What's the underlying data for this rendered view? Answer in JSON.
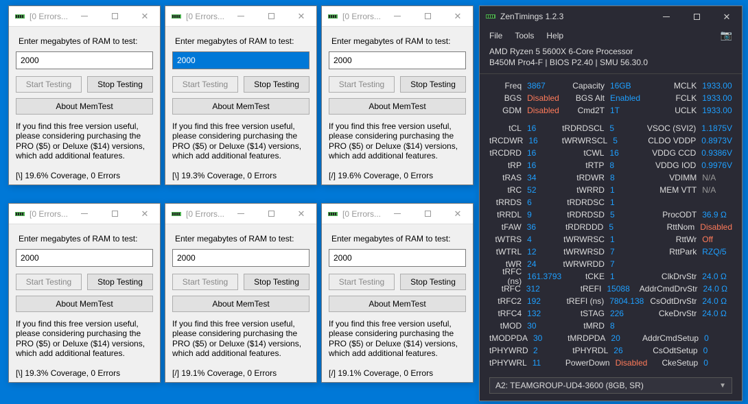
{
  "memtest": {
    "title": "[0 Errors...",
    "label": "Enter megabytes of RAM to test:",
    "value_default": "2000",
    "value_selected": "2000",
    "start": "Start Testing",
    "stop": "Stop Testing",
    "about": "About MemTest",
    "promo": "If you find this free version useful, please considering purchasing the PRO ($5) or Deluxe ($14) versions, which add additional features.",
    "windows": [
      {
        "status": "[\\]  19.6% Coverage, 0 Errors",
        "selected": false
      },
      {
        "status": "[\\]  19.3% Coverage, 0 Errors",
        "selected": true
      },
      {
        "status": "[/]  19.6% Coverage, 0 Errors",
        "selected": false
      },
      {
        "status": "[\\]  19.3% Coverage, 0 Errors",
        "selected": false
      },
      {
        "status": "[/]  19.1% Coverage, 0 Errors",
        "selected": false
      },
      {
        "status": "[/]  19.1% Coverage, 0 Errors",
        "selected": false
      }
    ]
  },
  "zen": {
    "title": "ZenTimings 1.2.3",
    "menu": {
      "file": "File",
      "tools": "Tools",
      "help": "Help"
    },
    "camera_icon": "📷",
    "sys1": "AMD Ryzen 5 5600X 6-Core Processor",
    "sys2": "B450M Pro4-F | BIOS P2.40 | SMU 56.30.0",
    "dropdown": "A2: TEAMGROUP-UD4-3600 (8GB, SR)",
    "rows": [
      {
        "c1l": "Freq",
        "c1v": "3867",
        "c1c": "",
        "c2l": "Capacity",
        "c2v": "16GB",
        "c2c": "",
        "c3l": "MCLK",
        "c3v": "1933.00",
        "c3c": ""
      },
      {
        "c1l": "BGS",
        "c1v": "Disabled",
        "c1c": "disabled",
        "c2l": "BGS Alt",
        "c2v": "Enabled",
        "c2c": "",
        "c3l": "FCLK",
        "c3v": "1933.00",
        "c3c": ""
      },
      {
        "c1l": "GDM",
        "c1v": "Disabled",
        "c1c": "disabled",
        "c2l": "Cmd2T",
        "c2v": "1T",
        "c2c": "",
        "c3l": "UCLK",
        "c3v": "1933.00",
        "c3c": ""
      },
      {
        "gap": true
      },
      {
        "c1l": "tCL",
        "c1v": "16",
        "c1c": "",
        "c2l": "tRDRDSCL",
        "c2v": "5",
        "c2c": "",
        "c3l": "VSOC (SVI2)",
        "c3v": "1.1875V",
        "c3c": ""
      },
      {
        "c1l": "tRCDWR",
        "c1v": "16",
        "c1c": "",
        "c2l": "tWRWRSCL",
        "c2v": "5",
        "c2c": "",
        "c3l": "CLDO VDDP",
        "c3v": "0.8973V",
        "c3c": ""
      },
      {
        "c1l": "tRCDRD",
        "c1v": "16",
        "c1c": "",
        "c2l": "tCWL",
        "c2v": "16",
        "c2c": "",
        "c3l": "VDDG CCD",
        "c3v": "0.9386V",
        "c3c": ""
      },
      {
        "c1l": "tRP",
        "c1v": "16",
        "c1c": "",
        "c2l": "tRTP",
        "c2v": "8",
        "c2c": "",
        "c3l": "VDDG IOD",
        "c3v": "0.9976V",
        "c3c": ""
      },
      {
        "c1l": "tRAS",
        "c1v": "34",
        "c1c": "",
        "c2l": "tRDWR",
        "c2v": "8",
        "c2c": "",
        "c3l": "VDIMM",
        "c3v": "N/A",
        "c3c": "na"
      },
      {
        "c1l": "tRC",
        "c1v": "52",
        "c1c": "",
        "c2l": "tWRRD",
        "c2v": "1",
        "c2c": "",
        "c3l": "MEM VTT",
        "c3v": "N/A",
        "c3c": "na"
      },
      {
        "c1l": "tRRDS",
        "c1v": "6",
        "c1c": "",
        "c2l": "tRDRDSC",
        "c2v": "1",
        "c2c": "",
        "c3l": "",
        "c3v": "",
        "c3c": ""
      },
      {
        "c1l": "tRRDL",
        "c1v": "9",
        "c1c": "",
        "c2l": "tRDRDSD",
        "c2v": "5",
        "c2c": "",
        "c3l": "ProcODT",
        "c3v": "36.9 Ω",
        "c3c": ""
      },
      {
        "c1l": "tFAW",
        "c1v": "36",
        "c1c": "",
        "c2l": "tRDRDDD",
        "c2v": "5",
        "c2c": "",
        "c3l": "RttNom",
        "c3v": "Disabled",
        "c3c": "disabled"
      },
      {
        "c1l": "tWTRS",
        "c1v": "4",
        "c1c": "",
        "c2l": "tWRWRSC",
        "c2v": "1",
        "c2c": "",
        "c3l": "RttWr",
        "c3v": "Off",
        "c3c": "disabled"
      },
      {
        "c1l": "tWTRL",
        "c1v": "12",
        "c1c": "",
        "c2l": "tWRWRSD",
        "c2v": "7",
        "c2c": "",
        "c3l": "RttPark",
        "c3v": "RZQ/5",
        "c3c": ""
      },
      {
        "c1l": "tWR",
        "c1v": "24",
        "c1c": "",
        "c2l": "tWRWRDD",
        "c2v": "7",
        "c2c": "",
        "c3l": "",
        "c3v": "",
        "c3c": ""
      },
      {
        "c1l": "tRFC (ns)",
        "c1v": "161.3793",
        "c1c": "",
        "c2l": "tCKE",
        "c2v": "1",
        "c2c": "",
        "c3l": "ClkDrvStr",
        "c3v": "24.0 Ω",
        "c3c": ""
      },
      {
        "c1l": "tRFC",
        "c1v": "312",
        "c1c": "",
        "c2l": "tREFI",
        "c2v": "15088",
        "c2c": "",
        "c3l": "AddrCmdDrvStr",
        "c3v": "24.0 Ω",
        "c3c": ""
      },
      {
        "c1l": "tRFC2",
        "c1v": "192",
        "c1c": "",
        "c2l": "tREFI (ns)",
        "c2v": "7804.138",
        "c2c": "",
        "c3l": "CsOdtDrvStr",
        "c3v": "24.0 Ω",
        "c3c": ""
      },
      {
        "c1l": "tRFC4",
        "c1v": "132",
        "c1c": "",
        "c2l": "tSTAG",
        "c2v": "226",
        "c2c": "",
        "c3l": "CkeDrvStr",
        "c3v": "24.0 Ω",
        "c3c": ""
      },
      {
        "c1l": "tMOD",
        "c1v": "30",
        "c1c": "",
        "c2l": "tMRD",
        "c2v": "8",
        "c2c": "",
        "c3l": "",
        "c3v": "",
        "c3c": ""
      },
      {
        "c1l": "tMODPDA",
        "c1v": "30",
        "c1c": "",
        "c2l": "tMRDPDA",
        "c2v": "20",
        "c2c": "",
        "c3l": "AddrCmdSetup",
        "c3v": "0",
        "c3c": ""
      },
      {
        "c1l": "tPHYWRD",
        "c1v": "2",
        "c1c": "",
        "c2l": "tPHYRDL",
        "c2v": "26",
        "c2c": "",
        "c3l": "CsOdtSetup",
        "c3v": "0",
        "c3c": ""
      },
      {
        "c1l": "tPHYWRL",
        "c1v": "11",
        "c1c": "",
        "c2l": "PowerDown",
        "c2v": "Disabled",
        "c2c": "disabled",
        "c3l": "CkeSetup",
        "c3v": "0",
        "c3c": ""
      }
    ]
  }
}
